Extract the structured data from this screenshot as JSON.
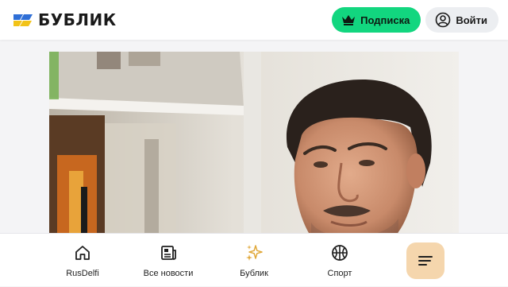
{
  "header": {
    "logo_text": "БУБЛИК",
    "subscribe_label": "Подписка",
    "login_label": "Войти",
    "subscribe_color": "#12d67f"
  },
  "article": {
    "photo_subject": "man-portrait"
  },
  "bottom_nav": {
    "items": [
      {
        "label": "RusDelfi",
        "icon": "home-icon"
      },
      {
        "label": "Все новости",
        "icon": "newspaper-icon"
      },
      {
        "label": "Бублик",
        "icon": "sparkles-icon"
      },
      {
        "label": "Спорт",
        "icon": "basketball-icon"
      }
    ],
    "menu_icon": "menu-icon",
    "menu_color": "#f5d6ad"
  }
}
